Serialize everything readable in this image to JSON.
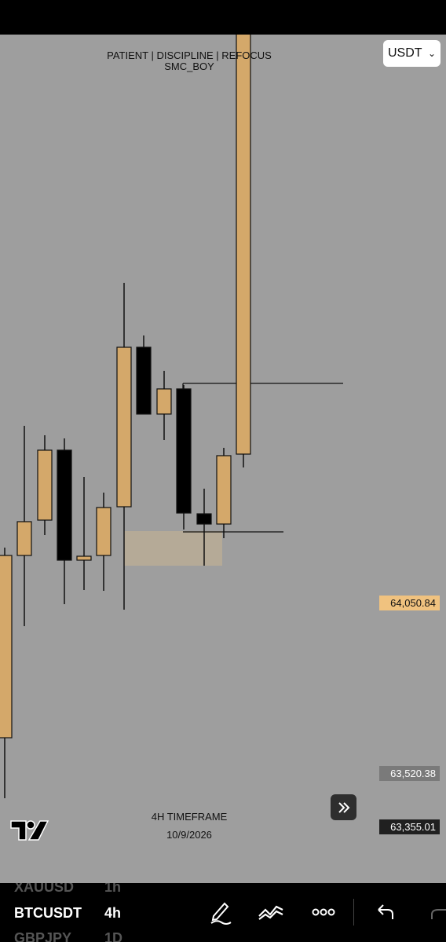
{
  "header": {
    "title_line1": "PATIENT | DISCIPLINE | REFOCUS",
    "title_line2": "SMC_BOY"
  },
  "symbol_select": {
    "value": "USDT"
  },
  "price_tags": {
    "current": "64,050.84",
    "level_a": "63,520.38",
    "level_b": "63,355.01"
  },
  "footer": {
    "timeframe_note": "4H TIMEFRAME",
    "date": "10/9/2026"
  },
  "watchlist": {
    "prev": {
      "symbol": "XAUUSD",
      "tf": "1h"
    },
    "current": {
      "symbol": "BTCUSDT",
      "tf": "4h"
    },
    "next": {
      "symbol": "GBPJPY",
      "tf": "1D"
    }
  },
  "toolbar": {
    "icons": [
      "pen-icon",
      "trend-line-icon",
      "more-icon",
      "undo-icon"
    ]
  },
  "colors": {
    "bull": "#d4a86a",
    "bear": "#000000",
    "background": "#9e9e9e",
    "zone": "#b8ab95"
  }
}
